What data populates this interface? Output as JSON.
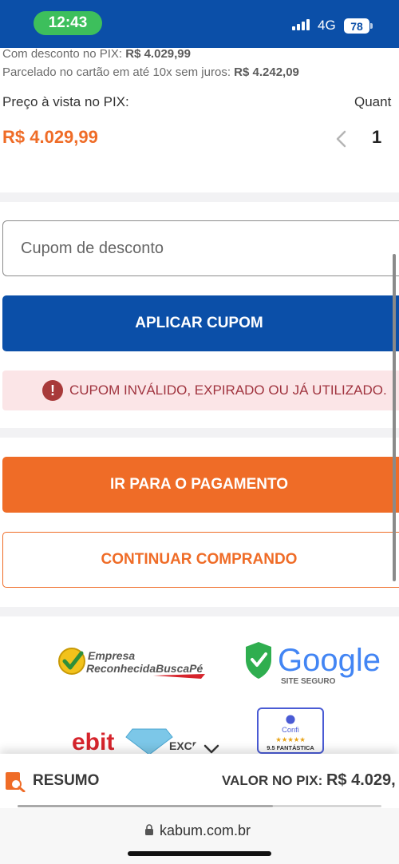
{
  "status_bar": {
    "time": "12:43",
    "network": "4G",
    "battery": "78"
  },
  "pricing": {
    "pix_discount_label": "Com desconto no PIX: ",
    "pix_discount_value": "R$ 4.029,99",
    "installment_label": "Parcelado no cartão em até 10x sem juros: ",
    "installment_value": "R$ 4.242,09",
    "pix_price_label": "Preço à vista no PIX:",
    "price": "R$ 4.029,99",
    "quantity_label": "Quant",
    "quantity": "1"
  },
  "coupon": {
    "placeholder": "Cupom de desconto",
    "apply_label": "APLICAR CUPOM",
    "error_icon": "!",
    "error_message": "CUPOM INVÁLIDO, EXPIRADO OU JÁ UTILIZADO."
  },
  "actions": {
    "pay_label": "IR PARA O PAGAMENTO",
    "continue_label": "CONTINUAR COMPRANDO"
  },
  "seals": {
    "buscape_line1": "Empresa",
    "buscape_line2": "ReconhecidaBuscaPé",
    "google_text": "Google",
    "google_sub": "SITE SEGURO",
    "ebit_text": "ebit",
    "ebit_tier": "EXCE",
    "confi_brand": "Confi",
    "confi_score": "9.5 FANTÁSTICA"
  },
  "summary": {
    "label": "RESUMO",
    "value_label": "VALOR NO PIX: ",
    "value": "R$ 4.029,"
  },
  "browser": {
    "url": "kabum.com.br"
  },
  "colors": {
    "brand_blue": "#0b4fa8",
    "brand_orange": "#ef6c27",
    "error_bg": "#fbe5e7",
    "error_text": "#a0343f"
  }
}
